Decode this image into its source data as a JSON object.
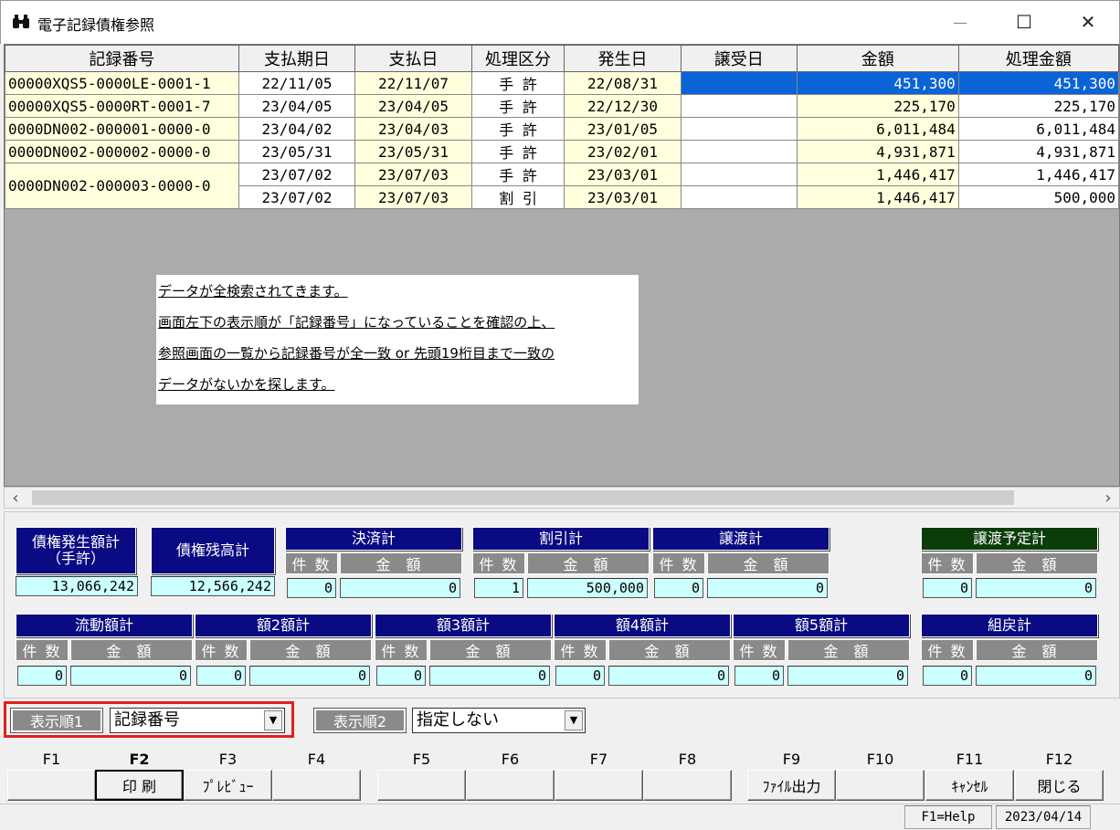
{
  "window": {
    "title": "電子記録債権参照",
    "minimize": "—",
    "maximize": "☐",
    "close": "✕"
  },
  "grid": {
    "headers": [
      "記録番号",
      "支払期日",
      "支払日",
      "処理区分",
      "発生日",
      "譲受日",
      "金額",
      "処理金額"
    ],
    "rows": [
      {
        "no": "00000XQS5-0000LE-0001-1",
        "due": "22/11/05",
        "pay": "22/11/07",
        "kind": "手 許",
        "issue": "22/08/31",
        "recv": "",
        "amount": "451,300",
        "proc": "451,300",
        "selected": true
      },
      {
        "no": "00000XQS5-0000RT-0001-7",
        "due": "23/04/05",
        "pay": "23/04/05",
        "kind": "手 許",
        "issue": "22/12/30",
        "recv": "",
        "amount": "225,170",
        "proc": "225,170"
      },
      {
        "no": "0000DN002-000001-0000-0",
        "due": "23/04/02",
        "pay": "23/04/03",
        "kind": "手 許",
        "issue": "23/01/05",
        "recv": "",
        "amount": "6,011,484",
        "proc": "6,011,484"
      },
      {
        "no": "0000DN002-000002-0000-0",
        "due": "23/05/31",
        "pay": "23/05/31",
        "kind": "手 許",
        "issue": "23/02/01",
        "recv": "",
        "amount": "4,931,871",
        "proc": "4,931,871"
      },
      {
        "no": "0000DN002-000003-0000-0",
        "due": "23/07/02",
        "pay": "23/07/03",
        "kind": "手 許",
        "issue": "23/03/01",
        "recv": "",
        "amount": "1,446,417",
        "proc": "1,446,417"
      },
      {
        "no": "",
        "due": "23/07/02",
        "pay": "23/07/03",
        "kind": "割 引",
        "issue": "23/03/01",
        "recv": "",
        "amount": "1,446,417",
        "proc": "500,000"
      }
    ]
  },
  "note": {
    "lines": [
      "データが全検索されてきます。",
      "画面左下の表示順が「記録番号」になっていることを確認の上、",
      "参照画面の一覧から記録番号が全一致 or 先頭19桁目まで一致の",
      "データがないかを探します。"
    ]
  },
  "scroll": {
    "left": "‹",
    "right": "›"
  },
  "totals": {
    "count_label": "件 数",
    "amount_label": "金 額",
    "issued": {
      "title": "債権発生額計\n（手許）",
      "value": "13,066,242"
    },
    "balance": {
      "title": "債権残高計",
      "value": "12,566,242"
    },
    "settled": {
      "title": "決済計",
      "count": "0",
      "amount": "0"
    },
    "discount": {
      "title": "割引計",
      "count": "1",
      "amount": "500,000"
    },
    "transfer": {
      "title": "譲渡計",
      "count": "0",
      "amount": "0"
    },
    "transfer_plan": {
      "title": "譲渡予定計",
      "count": "0",
      "amount": "0"
    },
    "flow": {
      "title": "流動額計",
      "count": "0",
      "amount": "0"
    },
    "k2": {
      "title": "額2額計",
      "count": "0",
      "amount": "0"
    },
    "k3": {
      "title": "額3額計",
      "count": "0",
      "amount": "0"
    },
    "k4": {
      "title": "額4額計",
      "count": "0",
      "amount": "0"
    },
    "k5": {
      "title": "額5額計",
      "count": "0",
      "amount": "0"
    },
    "kumimodoshi": {
      "title": "組戻計",
      "count": "0",
      "amount": "0"
    }
  },
  "sort": {
    "sort1_label": "表示順1",
    "sort1_value": "記録番号",
    "sort2_label": "表示順2",
    "sort2_value": "指定しない",
    "dropdown": "▼"
  },
  "fkeys": [
    {
      "key": "F1",
      "label": ""
    },
    {
      "key": "F2",
      "label": "印 刷"
    },
    {
      "key": "F3",
      "label": "ﾌﾟﾚﾋﾞｭｰ"
    },
    {
      "key": "F4",
      "label": ""
    },
    {
      "key": "F5",
      "label": ""
    },
    {
      "key": "F6",
      "label": ""
    },
    {
      "key": "F7",
      "label": ""
    },
    {
      "key": "F8",
      "label": ""
    },
    {
      "key": "F9",
      "label": "ﾌｧｲﾙ出力"
    },
    {
      "key": "F10",
      "label": ""
    },
    {
      "key": "F11",
      "label": "ｷｬﾝｾﾙ"
    },
    {
      "key": "F12",
      "label": "閉じる"
    }
  ],
  "status": {
    "help": "F1=Help",
    "date": "2023/04/14"
  }
}
